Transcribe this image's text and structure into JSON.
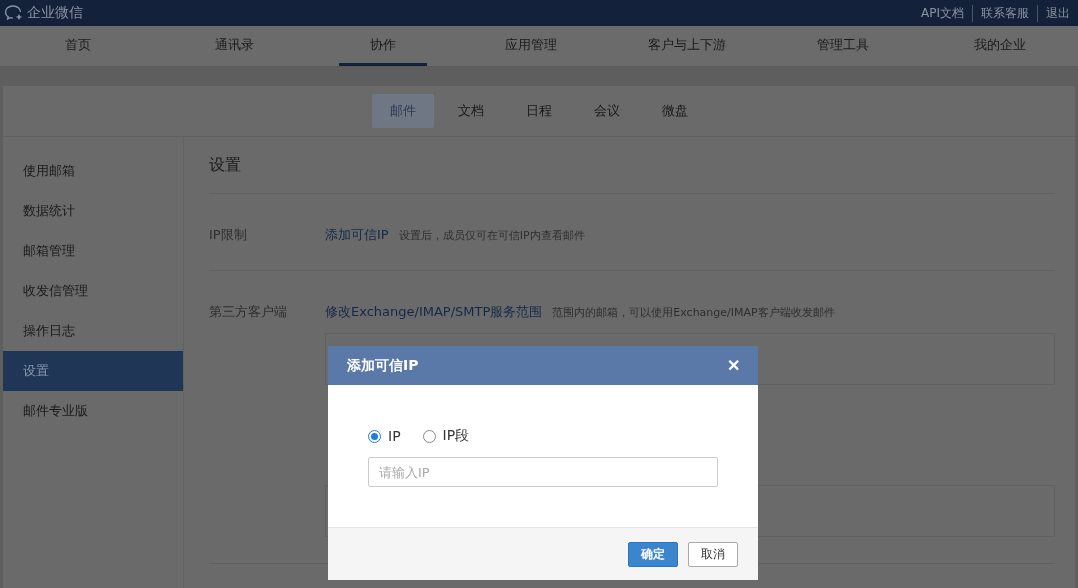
{
  "header": {
    "logo_text": "企业微信",
    "links": [
      "API文档",
      "联系客服",
      "退出"
    ]
  },
  "nav": [
    {
      "label": "首页",
      "selected": false
    },
    {
      "label": "通讯录",
      "selected": false
    },
    {
      "label": "协作",
      "selected": true
    },
    {
      "label": "应用管理",
      "selected": false
    },
    {
      "label": "客户与上下游",
      "selected": false
    },
    {
      "label": "管理工具",
      "selected": false
    },
    {
      "label": "我的企业",
      "selected": false
    }
  ],
  "subnav": [
    {
      "label": "邮件",
      "selected": true
    },
    {
      "label": "文档",
      "selected": false
    },
    {
      "label": "日程",
      "selected": false
    },
    {
      "label": "会议",
      "selected": false
    },
    {
      "label": "微盘",
      "selected": false
    }
  ],
  "sidebar": [
    {
      "label": "使用邮箱",
      "selected": false
    },
    {
      "label": "数据统计",
      "selected": false
    },
    {
      "label": "邮箱管理",
      "selected": false
    },
    {
      "label": "收发信管理",
      "selected": false
    },
    {
      "label": "操作日志",
      "selected": false
    },
    {
      "label": "设置",
      "selected": true
    },
    {
      "label": "邮件专业版",
      "selected": false
    }
  ],
  "content": {
    "title": "设置",
    "sections": [
      {
        "label": "IP限制",
        "link": "添加可信IP",
        "hint": "设置后，成员仅可在可信IP内查看邮件",
        "has_box": false
      },
      {
        "label": "第三方客户端",
        "link": "修改Exchange/IMAP/SMTP服务范围",
        "hint": "范围内的邮箱，可以使用Exchange/IMAP客户端收发邮件",
        "has_box": true
      }
    ]
  },
  "dialog": {
    "title": "添加可信IP",
    "close": "✕",
    "options": [
      {
        "label": "IP",
        "selected": true
      },
      {
        "label": "IP段",
        "selected": false
      }
    ],
    "placeholder": "请输入IP",
    "buttons": [
      {
        "label": "确定",
        "kind": "primary"
      },
      {
        "label": "取消",
        "kind": "secondary"
      }
    ]
  }
}
